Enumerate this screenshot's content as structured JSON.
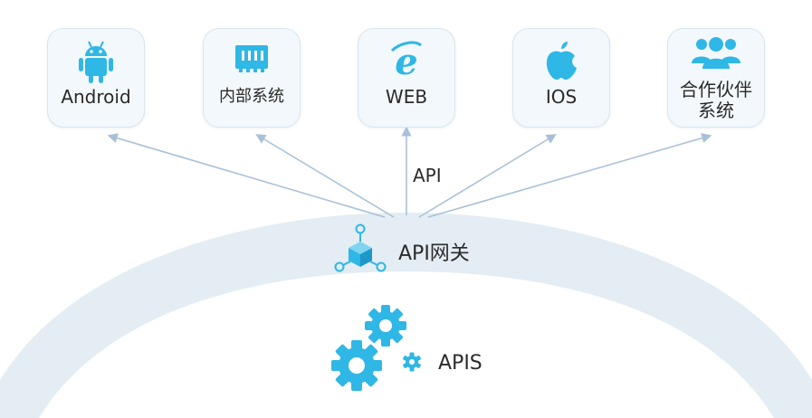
{
  "clients": [
    {
      "id": "android",
      "label": "Android",
      "icon": "android-icon"
    },
    {
      "id": "internal",
      "label": "内部系统",
      "icon": "server-rack-icon"
    },
    {
      "id": "web",
      "label": "WEB",
      "icon": "internet-explorer-icon"
    },
    {
      "id": "ios",
      "label": "IOS",
      "icon": "apple-icon"
    },
    {
      "id": "partner",
      "label": "合作伙伴\n系统",
      "icon": "users-group-icon"
    }
  ],
  "connection_label": "API",
  "gateway": {
    "label": "API网关",
    "icon": "network-cube-icon"
  },
  "services": {
    "label": "APIS",
    "icon": "gears-icon"
  },
  "colors": {
    "icon": "#2fb7e6",
    "arrow": "#a9c1d8",
    "arc": "#e3edf3",
    "card_bg": "#f3f8fc",
    "card_border": "#d8e6f1",
    "text": "#2a2a2a"
  }
}
